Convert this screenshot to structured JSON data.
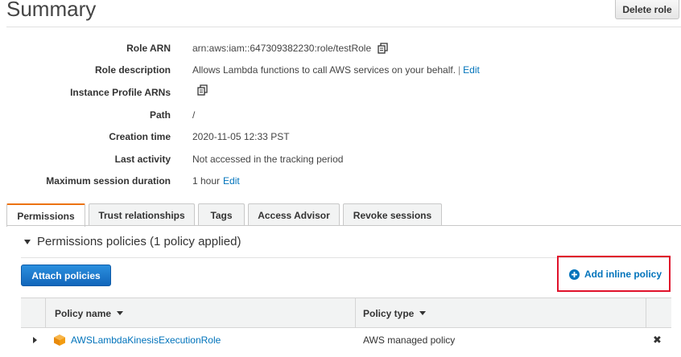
{
  "header": {
    "title": "Summary",
    "delete_button": "Delete role"
  },
  "details": {
    "role_arn": {
      "label": "Role ARN",
      "value": "arn:aws:iam::647309382230:role/testRole"
    },
    "role_description": {
      "label": "Role description",
      "value": "Allows Lambda functions to call AWS services on your behalf.",
      "separator": "|",
      "edit": "Edit"
    },
    "instance_profile": {
      "label": "Instance Profile ARNs"
    },
    "path": {
      "label": "Path",
      "value": "/"
    },
    "creation_time": {
      "label": "Creation time",
      "value": "2020-11-05 12:33 PST"
    },
    "last_activity": {
      "label": "Last activity",
      "value": "Not accessed in the tracking period"
    },
    "max_session": {
      "label": "Maximum session duration",
      "value": "1 hour",
      "edit": "Edit"
    }
  },
  "tabs": [
    {
      "label": "Permissions",
      "active": true
    },
    {
      "label": "Trust relationships",
      "active": false
    },
    {
      "label": "Tags",
      "active": false
    },
    {
      "label": "Access Advisor",
      "active": false
    },
    {
      "label": "Revoke sessions",
      "active": false
    }
  ],
  "permissions": {
    "section_title": "Permissions policies (1 policy applied)",
    "attach_button": "Attach policies",
    "add_inline": "Add inline policy",
    "table": {
      "columns": [
        "Policy name",
        "Policy type"
      ],
      "rows": [
        {
          "name": "AWSLambdaKinesisExecutionRole",
          "type": "AWS managed policy",
          "remove": "✖"
        }
      ]
    }
  },
  "colors": {
    "link": "#0073bb",
    "primary_button": "#1166bb",
    "active_tab_accent": "#ec7211",
    "highlight_box": "#e0122b",
    "policy_icon": "#f39c12"
  },
  "icons": {
    "copy": "copy-icon",
    "add": "plus-circle-icon",
    "policy": "cube-icon",
    "remove": "close-icon"
  }
}
